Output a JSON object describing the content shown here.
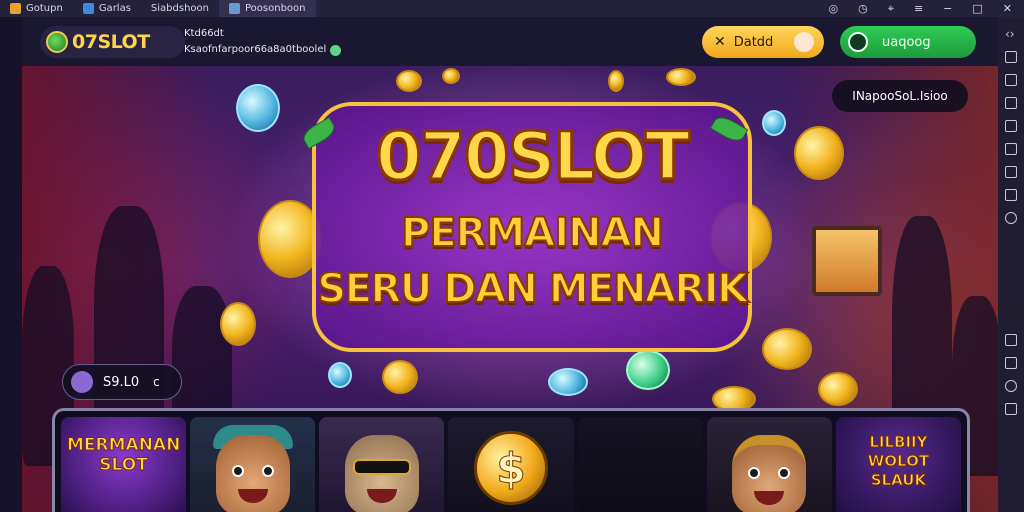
{
  "window": {
    "tabs": [
      {
        "label": "Gotupn"
      },
      {
        "label": "Garlas"
      },
      {
        "label": "Siabdshoon"
      },
      {
        "label": "Poosonboon"
      }
    ]
  },
  "header": {
    "logo_text": "07SLOT",
    "user_name": "Ktd66dt",
    "user_sub": "Ksaofnfarpoor66a8a0tboolel",
    "register_label": "Datdd",
    "login_label": "uaqoog"
  },
  "hero": {
    "title": "070SLOT",
    "subtitle_line1": "PERMAINAN",
    "subtitle_line2": "SERU DAN MENARIK",
    "notice_label": "INapooSoL.Isioo",
    "balance_value": "S9.L0",
    "balance_chevron": "c"
  },
  "games": [
    {
      "label": "MERMANAN SLOT",
      "theme": "slot-logo"
    },
    {
      "label": "",
      "theme": "bear"
    },
    {
      "label": "",
      "theme": "bear-shades"
    },
    {
      "label": "$",
      "theme": "dollar-coin"
    },
    {
      "label": "",
      "theme": "empty"
    },
    {
      "label": "",
      "theme": "bear-girl"
    },
    {
      "label": "LILBIIY WOLOT SLAUK",
      "theme": "slot-logo-2"
    }
  ],
  "colors": {
    "accent_gold": "#ffd84a",
    "login_green": "#2ecc55",
    "register_yellow": "#f0a81c",
    "header_bg": "#1a1730"
  }
}
